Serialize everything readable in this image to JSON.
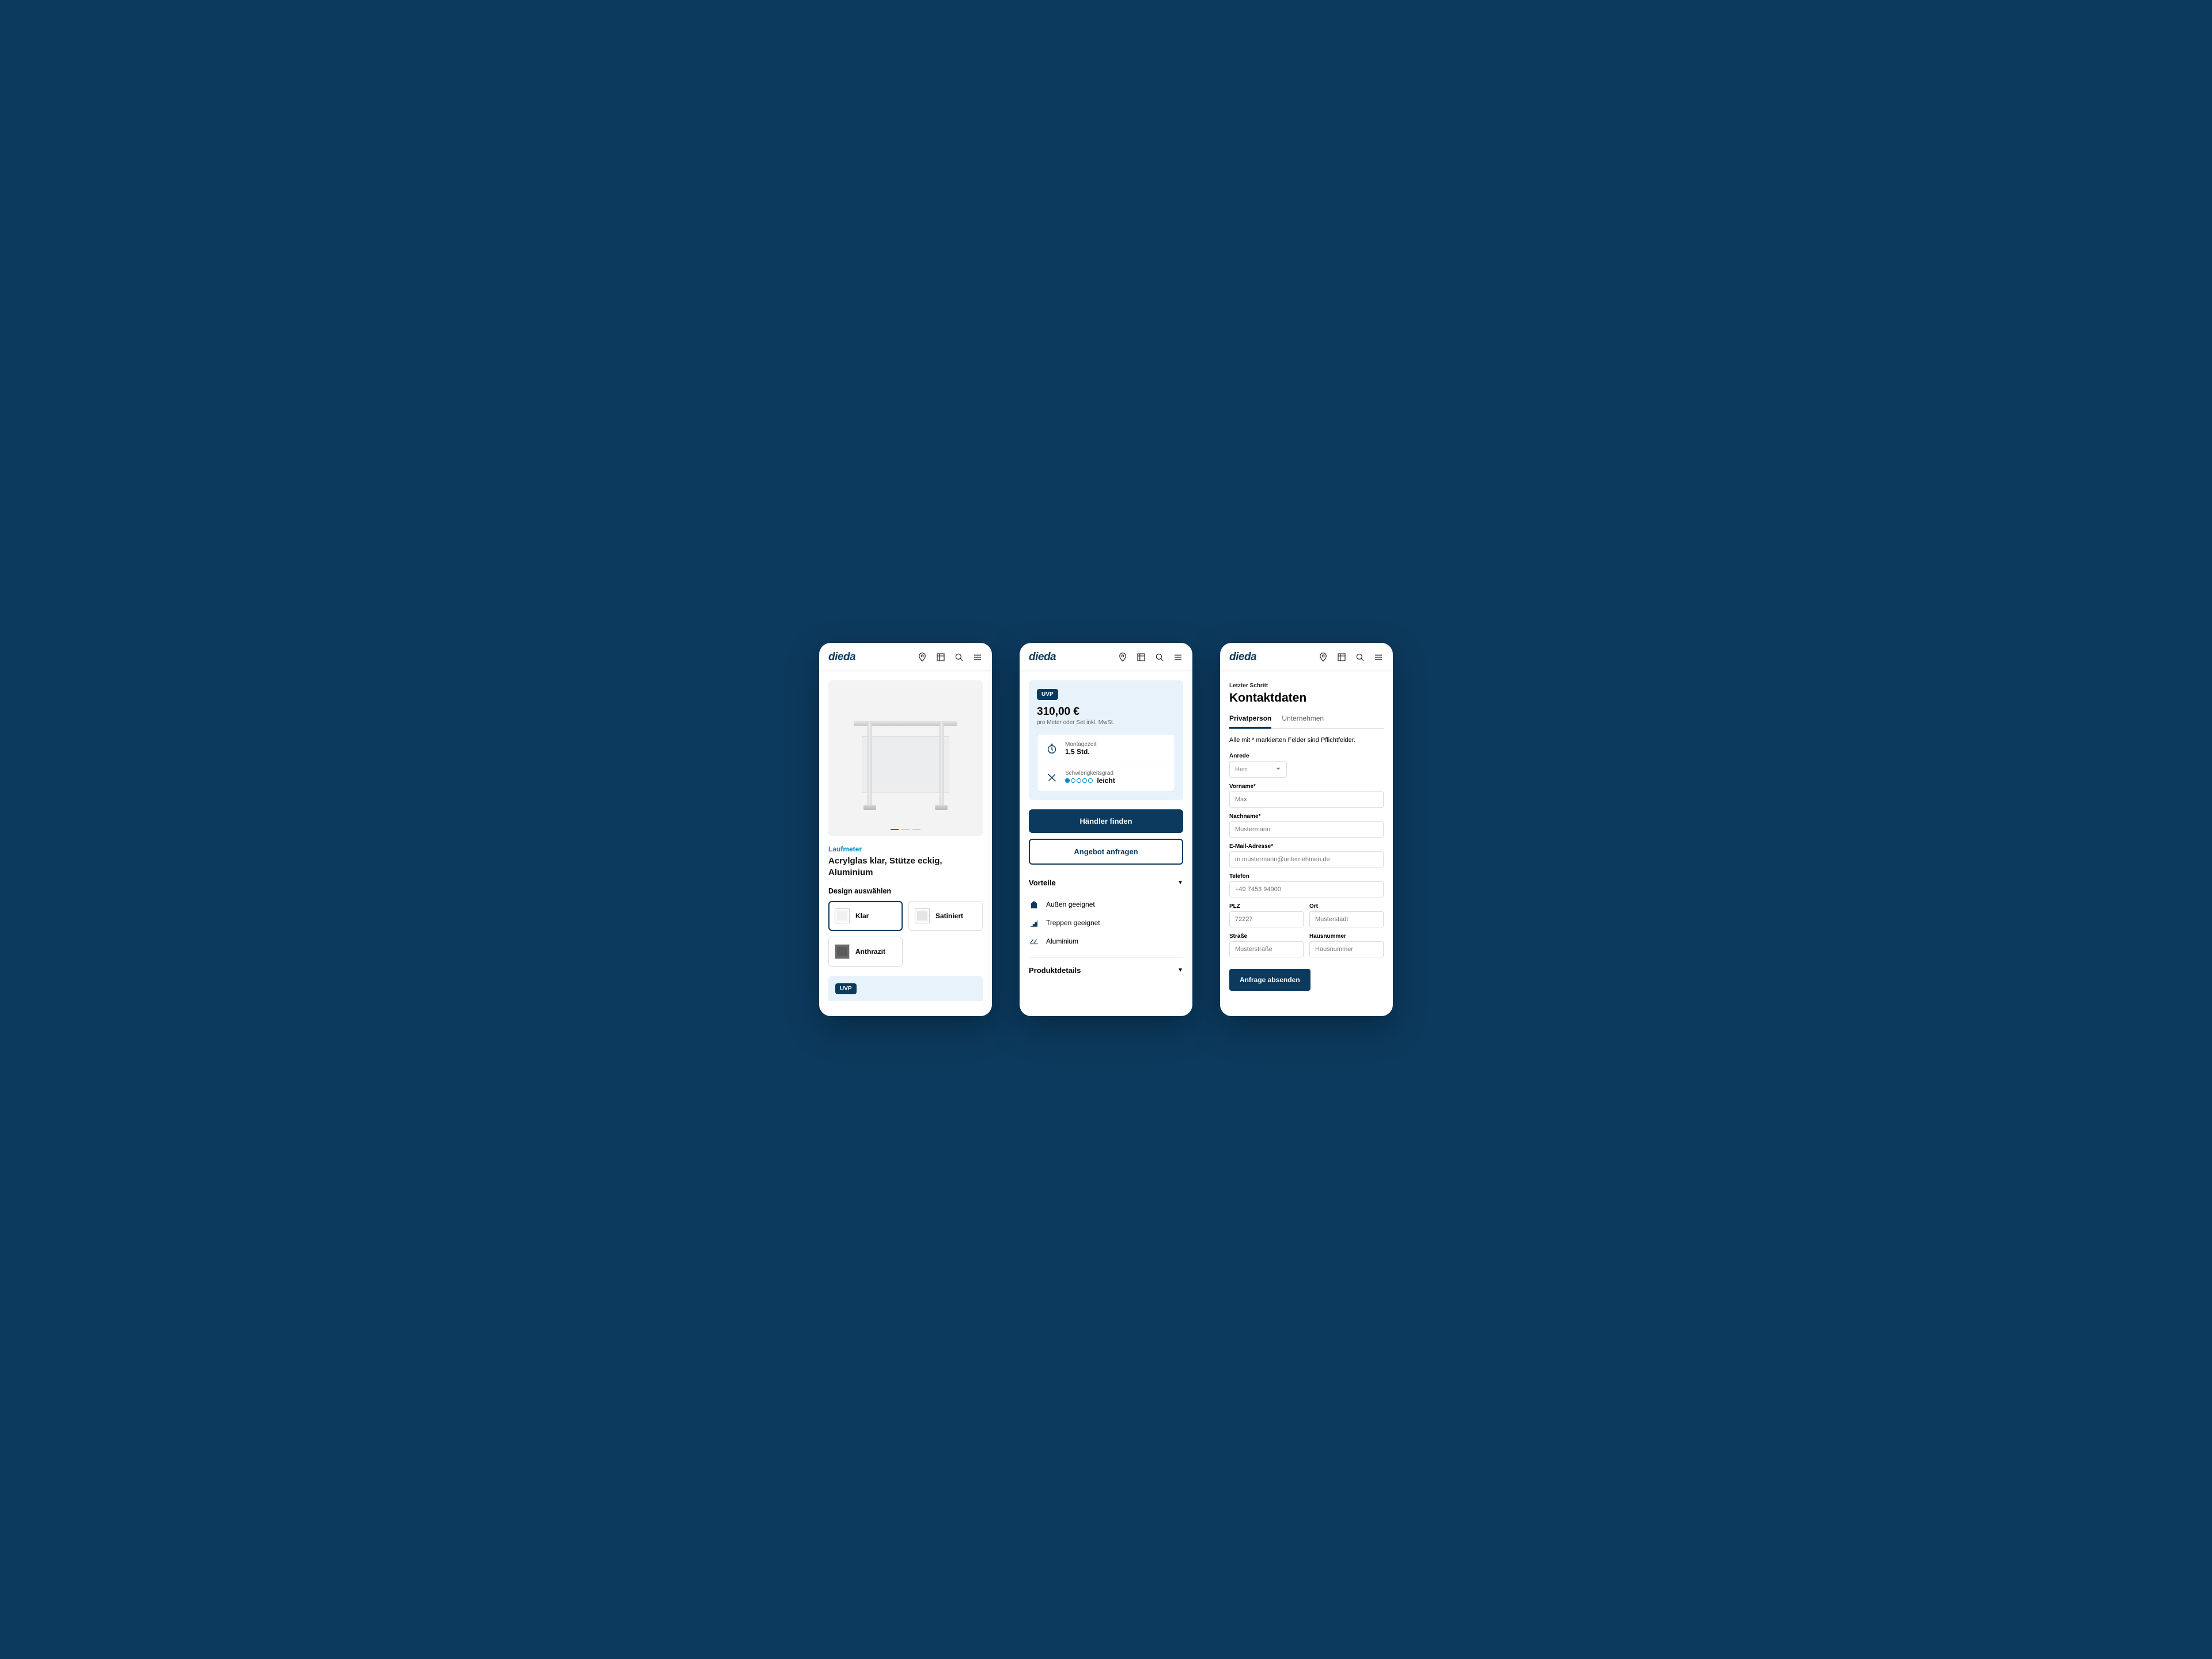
{
  "brand": "dieda",
  "screen1": {
    "category": "Laufmeter",
    "title": "Acrylglas klar, Stütze eckig, Aluminium",
    "design_label": "Design auswählen",
    "designs": [
      {
        "label": "Klar",
        "selected": true
      },
      {
        "label": "Satiniert",
        "selected": false
      },
      {
        "label": "Anthrazit",
        "selected": false
      }
    ],
    "uvp": "UVP"
  },
  "screen2": {
    "uvp": "UVP",
    "price": "310,00 €",
    "price_note": "pro Meter oder Set inkl. MwSt.",
    "assembly_label": "Montagezeit",
    "assembly_value": "1,5 Std.",
    "difficulty_label": "Schwierigkeitsgrad",
    "difficulty_value": "leicht",
    "btn_dealer": "Händler finden",
    "btn_request": "Angebot anfragen",
    "advantages_label": "Vorteile",
    "features": [
      "Außen geeignet",
      "Treppen geeignet",
      "Aluminium"
    ],
    "details_label": "Produktdetails"
  },
  "screen3": {
    "step": "Letzter Schritt",
    "heading": "Kontaktdaten",
    "tabs": {
      "private": "Privatperson",
      "company": "Unternehmen"
    },
    "note": "Alle mit * markierten Felder sind Pflichtfelder.",
    "fields": {
      "anrede_label": "Anrede",
      "anrede_value": "Herr",
      "vorname_label": "Vorname*",
      "vorname_ph": "Max",
      "nachname_label": "Nachname*",
      "nachname_ph": "Mustermann",
      "email_label": "E-Mail-Adresse*",
      "email_ph": "m.mustermann@unternehmen.de",
      "tel_label": "Telefon",
      "tel_ph": "+49 7453 94900",
      "plz_label": "PLZ",
      "plz_ph": "72227",
      "ort_label": "Ort",
      "ort_ph": "Musterstadt",
      "strasse_label": "Straße",
      "strasse_ph": "Musterstraße",
      "nr_label": "Hausnummer",
      "nr_ph": "Hausnummer"
    },
    "submit": "Anfrage absenden"
  }
}
